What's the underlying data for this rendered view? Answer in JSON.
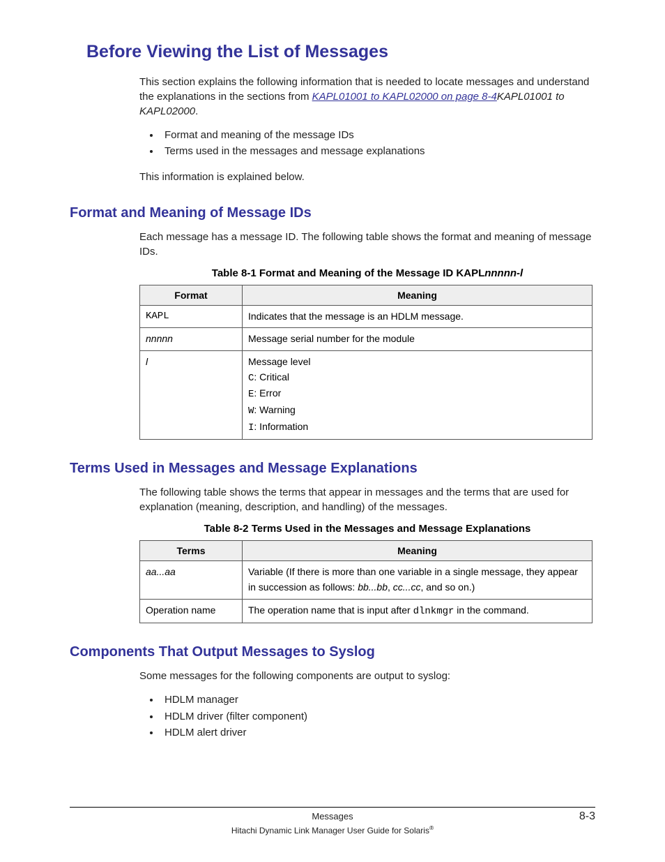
{
  "headings": {
    "main": "Before Viewing the List of Messages",
    "sub1": "Format and Meaning of Message IDs",
    "sub2": "Terms Used in Messages and Message Explanations",
    "sub3": "Components That Output Messages to Syslog"
  },
  "intro": {
    "para1_pre": "This section explains the following information that is needed to locate messages and understand the explanations in the sections from ",
    "link_text": "KAPL01001 to KAPL02000 on page 8-4",
    "para1_post_italic": "KAPL01001 to KAPL02000",
    "para1_post_plain": ".",
    "bullets": [
      "Format and meaning of the message IDs",
      "Terms used in the messages and message explanations"
    ],
    "para2": "This information is explained below."
  },
  "section1": {
    "para": "Each message has a message ID. The following table shows the format and meaning of message IDs.",
    "caption_pre": "Table 8-1 Format and Meaning of the Message ID KAPL",
    "caption_ital": "nnnnn-l",
    "headers": {
      "c1": "Format",
      "c2": "Meaning"
    },
    "rows": {
      "r1": {
        "fmt": "KAPL",
        "meaning": "Indicates that the message is an HDLM message."
      },
      "r2": {
        "fmt": "nnnnn",
        "meaning": "Message serial number for the module"
      },
      "r3": {
        "fmt": "l",
        "line1": "Message level",
        "c": "C",
        "c_txt": ": Critical",
        "e": "E",
        "e_txt": ": Error",
        "w": "W",
        "w_txt": ": Warning",
        "i": "I",
        "i_txt": ": Information"
      }
    }
  },
  "section2": {
    "para": "The following table shows the terms that appear in messages and the terms that are used for explanation (meaning, description, and handling) of the messages.",
    "caption": "Table 8-2 Terms Used in the Messages and Message Explanations",
    "headers": {
      "c1": "Terms",
      "c2": "Meaning"
    },
    "rows": {
      "r1": {
        "term": "aa...aa",
        "m_pre": "Variable (If there is more than one variable in a single message, they appear in succession as follows: ",
        "m_i1": "bb...bb",
        "m_mid": ", ",
        "m_i2": "cc...cc",
        "m_post": ", and so on.)"
      },
      "r2": {
        "term": "Operation name",
        "m_pre": "The operation name that is input after ",
        "m_code": "dlnkmgr",
        "m_post": " in the command."
      }
    }
  },
  "section3": {
    "para": "Some messages for the following components are output to syslog:",
    "bullets": [
      "HDLM manager",
      "HDLM driver (filter component)",
      "HDLM alert driver"
    ]
  },
  "footer": {
    "center": "Messages",
    "right": "8-3",
    "line2_pre": "Hitachi Dynamic Link Manager User Guide for Solaris",
    "reg": "®"
  }
}
